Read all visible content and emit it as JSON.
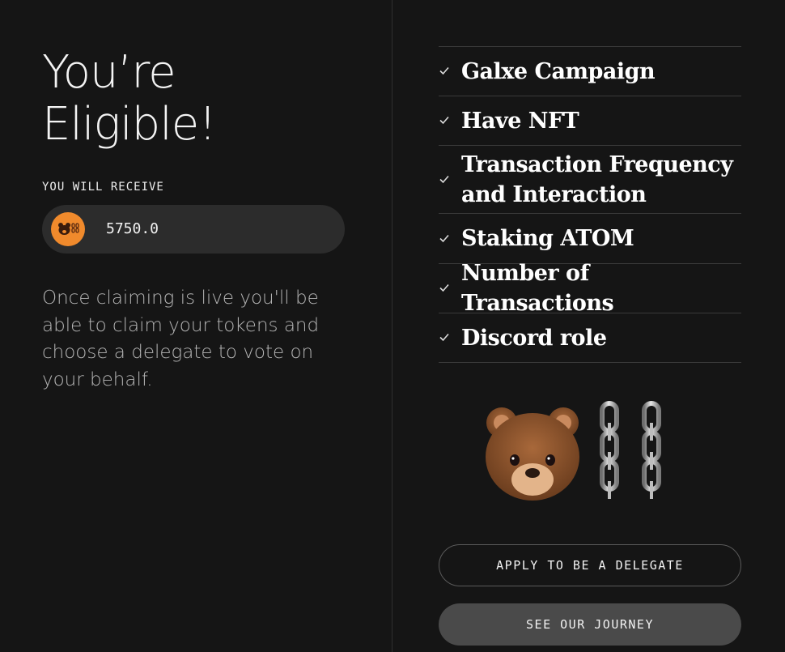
{
  "hero": {
    "headline_line1": "You’re",
    "headline_line2": "Eligible!"
  },
  "reward": {
    "label": "YOU WILL RECEIVE",
    "amount": "5750.0",
    "token_icon": "bear-chain-token-icon"
  },
  "info": {
    "text": "Once claiming is live you'll be able to claim your tokens and choose a delegate to vote on your behalf."
  },
  "criteria": [
    {
      "label": "Galxe Campaign",
      "icon": "check-icon"
    },
    {
      "label": "Have NFT",
      "icon": "check-icon"
    },
    {
      "label": "Transaction Frequency and Interaction",
      "icon": "check-icon"
    },
    {
      "label": "Staking ATOM",
      "icon": "check-icon"
    },
    {
      "label": "Number of Transactions",
      "icon": "check-icon"
    },
    {
      "label": "Discord role",
      "icon": "check-icon"
    }
  ],
  "mascot": {
    "icon": "bear-chain-mascot"
  },
  "actions": {
    "apply_label": "APPLY TO BE A DELEGATE",
    "journey_label": "SEE OUR JOURNEY"
  },
  "colors": {
    "background": "#151515",
    "token_orange": "#f08a2c",
    "pill_bg": "#2c2c2c",
    "filled_button": "#4a4a4a"
  }
}
